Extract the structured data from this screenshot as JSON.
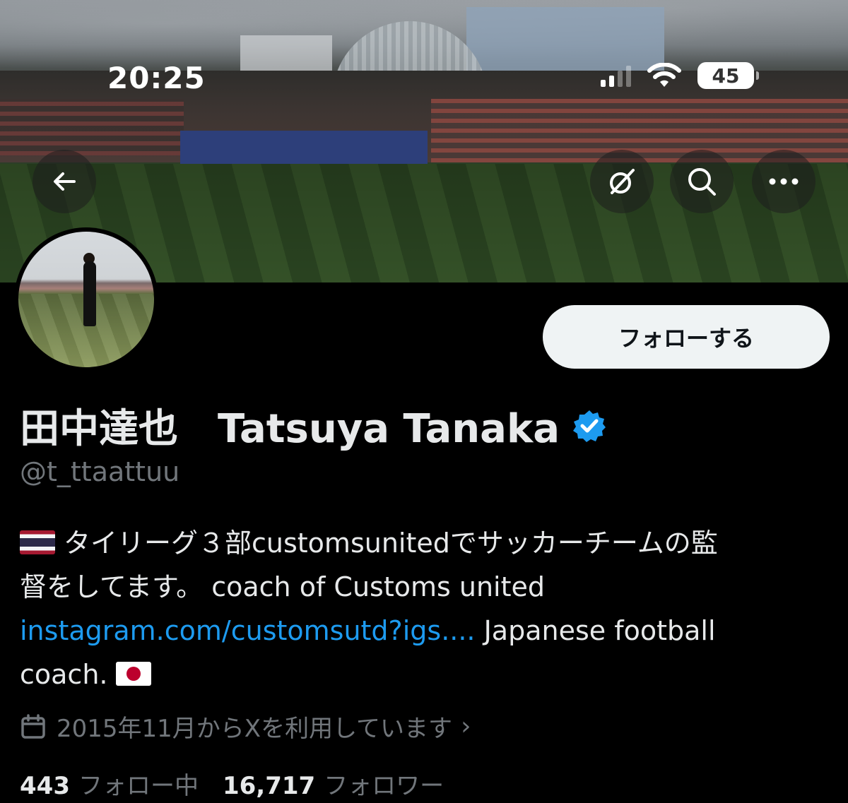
{
  "status_bar": {
    "time": "20:25",
    "battery": "45"
  },
  "header": {
    "back_icon": "arrow-left-icon",
    "grok_icon": "grok-slash-icon",
    "search_icon": "search-icon",
    "more_icon": "more-horizontal-icon"
  },
  "profile": {
    "display_name": "田中達也　Tatsuya Tanaka",
    "handle": "@t_ttaattuu",
    "verified": true,
    "follow_label": "フォローする",
    "bio": {
      "line1": "タイリーグ３部customsunitedでサッカーチームの監",
      "line2": "督をしてます。 coach of Customs united",
      "link": "instagram.com/customsutd?igs....",
      "line3_rest": " Japanese football",
      "line4": "coach."
    },
    "joined": "2015年11月からXを利用しています",
    "following_count": "443",
    "following_label": "フォロー中",
    "followers_count": "16,717",
    "followers_label": "フォロワー"
  },
  "colors": {
    "link": "#1d9bf0",
    "verified": "#1d9bf0",
    "muted": "#71767b"
  }
}
